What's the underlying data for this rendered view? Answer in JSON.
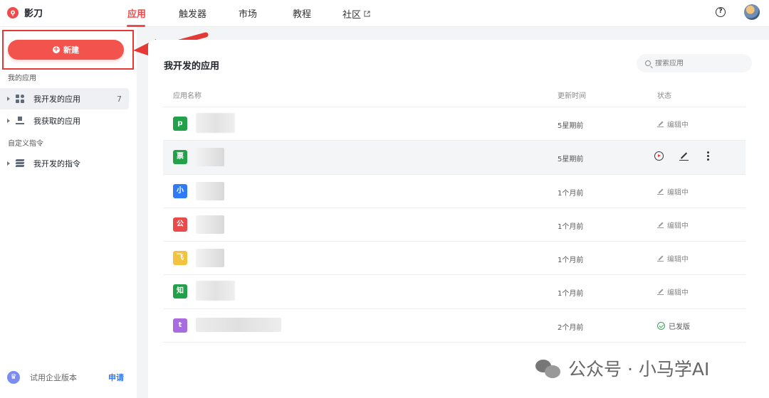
{
  "brand": {
    "name": "影刀"
  },
  "nav": [
    {
      "label": "应用",
      "active": true
    },
    {
      "label": "触发器"
    },
    {
      "label": "市场"
    },
    {
      "label": "教程"
    },
    {
      "label": "社区"
    }
  ],
  "sidebar": {
    "new_label": "新建",
    "my_apps_label": "我的应用",
    "items": [
      {
        "label": "我开发的应用",
        "count": "7",
        "icon": "grid-icon"
      },
      {
        "label": "我获取的应用",
        "icon": "download-icon"
      }
    ],
    "custom_commands_label": "自定义指令",
    "command_items": [
      {
        "label": "我开发的指令",
        "icon": "layers-icon"
      }
    ],
    "trial_text": "试用企业版本",
    "trial_apply": "申请"
  },
  "main": {
    "title": "我开发的应用",
    "search_placeholder": "搜索应用",
    "columns": {
      "name": "应用名称",
      "updated": "更新时间",
      "status": "状态"
    },
    "rows": [
      {
        "initial": "p",
        "color": "#23a04a",
        "updated": "5星期前",
        "status": "编辑中",
        "state": "editing"
      },
      {
        "initial": "票",
        "color": "#23a04a",
        "updated": "5星期前",
        "status": "",
        "state": "hover"
      },
      {
        "initial": "小",
        "color": "#2f7bf5",
        "updated": "1个月前",
        "status": "编辑中",
        "state": "editing"
      },
      {
        "initial": "公",
        "color": "#e94b4b",
        "updated": "1个月前",
        "status": "编辑中",
        "state": "editing"
      },
      {
        "initial": "飞",
        "color": "#f2c33f",
        "updated": "1个月前",
        "status": "编辑中",
        "state": "editing"
      },
      {
        "initial": "知",
        "color": "#23a04a",
        "updated": "1个月前",
        "status": "编辑中",
        "state": "editing"
      },
      {
        "initial": "t",
        "color": "#a86be0",
        "updated": "2个月前",
        "status": "已发版",
        "state": "published"
      }
    ]
  },
  "watermark": {
    "text": "公众号 · 小马学AI"
  },
  "colors": {
    "accent": "#f04a4a",
    "link": "#2f7bf5",
    "success": "#2eaa4d"
  }
}
